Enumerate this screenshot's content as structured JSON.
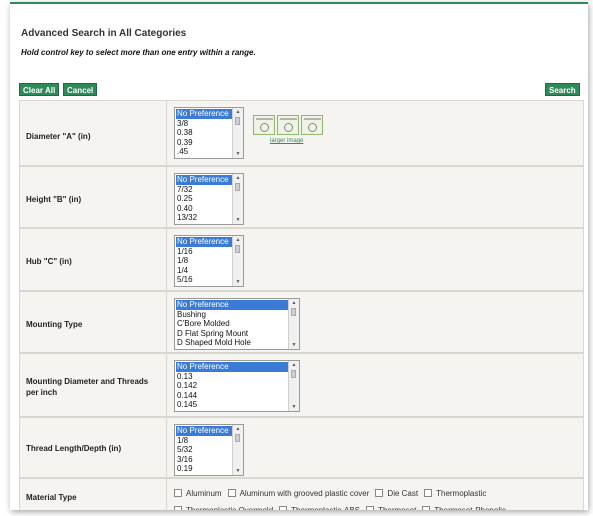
{
  "header": {
    "title": "Advanced Search in All Categories",
    "hint": "Hold control key to select more than one entry within a range."
  },
  "toolbar": {
    "clear_all": "Clear All",
    "cancel": "Cancel",
    "search": "Search"
  },
  "filters": {
    "diameter": {
      "label": "Diameter \"A\" (in)",
      "options": [
        "No Preference",
        "3/8",
        "0.38",
        "0.39",
        ".45"
      ],
      "selected": "No Preference",
      "larger_image": "larger image"
    },
    "height": {
      "label": "Height \"B\" (in)",
      "options": [
        "No Preference",
        "7/32",
        "0.25",
        "0.40",
        "13/32"
      ],
      "selected": "No Preference"
    },
    "hub": {
      "label": "Hub \"C\" (in)",
      "options": [
        "No Preference",
        "1/16",
        "1/8",
        "1/4",
        "5/16"
      ],
      "selected": "No Preference"
    },
    "mounting_type": {
      "label": "Mounting Type",
      "options": [
        "No Preference",
        "Bushing",
        "C'Bore Molded",
        "D Flat Spring Mount",
        "D Shaped Mold Hole"
      ],
      "selected": "No Preference"
    },
    "mounting_diameter": {
      "label": "Mounting Diameter and Threads per inch",
      "options": [
        "No Preference",
        "0.13",
        "0.142",
        "0.144",
        "0.145"
      ],
      "selected": "No Preference"
    },
    "thread_length": {
      "label": "Thread Length/Depth (in)",
      "options": [
        "No Preference",
        "1/8",
        "5/32",
        "3/16",
        "0.19"
      ],
      "selected": "No Preference"
    },
    "material_type": {
      "label": "Material Type",
      "options": [
        "Aluminum",
        "Aluminum with grooved plastic cover",
        "Die Cast",
        "Thermoplastic",
        "Thermoplastic Overmold",
        "Thermoplastic-ABS",
        "Thermoset",
        "Thermoset-Phenolic"
      ]
    }
  },
  "colors": {
    "accent": "#2f8a5a",
    "row_background": "#f5f4f0",
    "selection": "#3a7bd5"
  }
}
